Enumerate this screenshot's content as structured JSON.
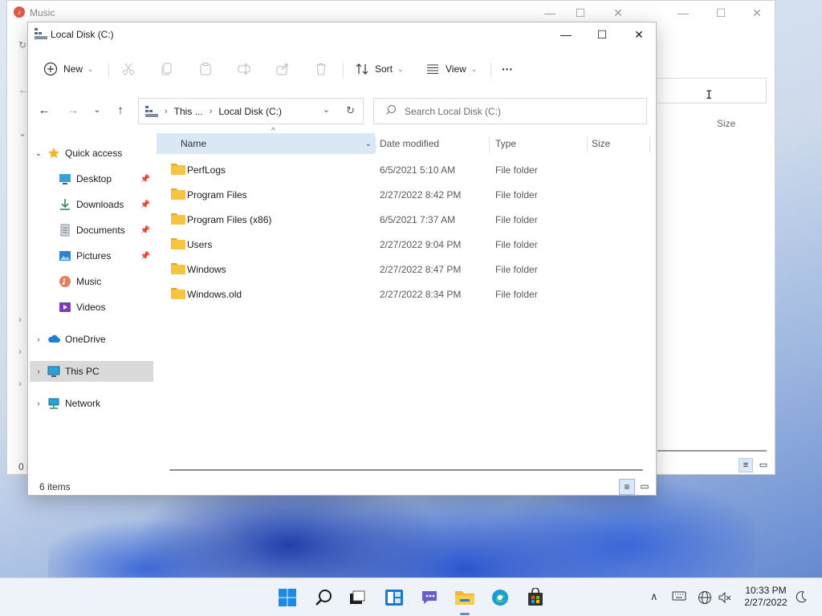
{
  "background_window": {
    "title": "Music",
    "size_header": "Size",
    "status_fragment": "0 i"
  },
  "window": {
    "title": "Local Disk (C:)",
    "controls": {
      "minimize": "—",
      "maximize": "☐",
      "close": "✕"
    }
  },
  "toolbar": {
    "new_label": "New",
    "sort_label": "Sort",
    "view_label": "View",
    "more_label": "···"
  },
  "address": {
    "crumbs": [
      "This ...",
      "Local Disk (C:)"
    ]
  },
  "search": {
    "placeholder": "Search Local Disk (C:)"
  },
  "sidebar": {
    "items": [
      {
        "label": "Quick access",
        "icon": "star-icon"
      },
      {
        "label": "Desktop",
        "icon": "desktop-icon",
        "pinned": true
      },
      {
        "label": "Downloads",
        "icon": "download-icon",
        "pinned": true
      },
      {
        "label": "Documents",
        "icon": "document-icon",
        "pinned": true
      },
      {
        "label": "Pictures",
        "icon": "picture-icon",
        "pinned": true
      },
      {
        "label": "Music",
        "icon": "music-icon"
      },
      {
        "label": "Videos",
        "icon": "video-icon"
      },
      {
        "label": "OneDrive",
        "icon": "cloud-icon"
      },
      {
        "label": "This PC",
        "icon": "monitor-icon",
        "selected": true
      },
      {
        "label": "Network",
        "icon": "network-icon"
      }
    ]
  },
  "columns": {
    "name": "Name",
    "date": "Date modified",
    "type": "Type",
    "size": "Size"
  },
  "files": [
    {
      "name": "PerfLogs",
      "date": "6/5/2021 5:10 AM",
      "type": "File folder"
    },
    {
      "name": "Program Files",
      "date": "2/27/2022 8:42 PM",
      "type": "File folder"
    },
    {
      "name": "Program Files (x86)",
      "date": "6/5/2021 7:37 AM",
      "type": "File folder"
    },
    {
      "name": "Users",
      "date": "2/27/2022 9:04 PM",
      "type": "File folder"
    },
    {
      "name": "Windows",
      "date": "2/27/2022 8:47 PM",
      "type": "File folder"
    },
    {
      "name": "Windows.old",
      "date": "2/27/2022 8:34 PM",
      "type": "File folder"
    }
  ],
  "status": {
    "item_count": "6 items"
  },
  "taskbar": {
    "time": "10:33 PM",
    "date": "2/27/2022"
  },
  "colors": {
    "accent": "#0067c0",
    "folder": "#f5c440",
    "selected_header": "#dae8f6",
    "taskbar": "#eef2f9"
  }
}
